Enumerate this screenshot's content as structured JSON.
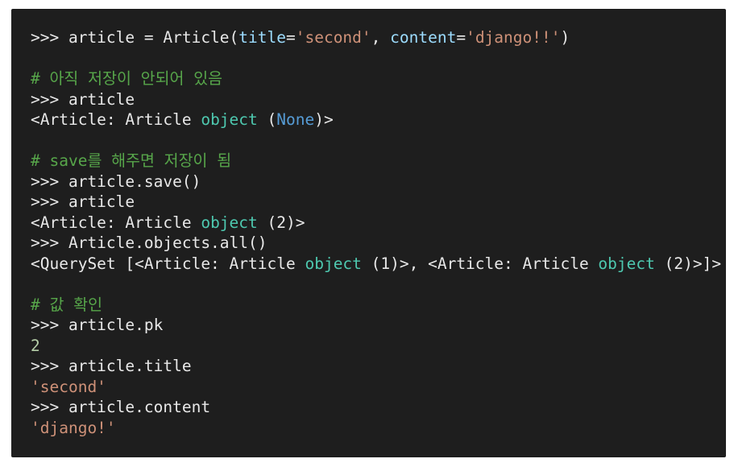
{
  "colors": {
    "background": "#1e1e1e",
    "text": "#e8e8e8",
    "comment": "#57a64a",
    "string": "#ce9178",
    "keyword": "#4ec9b0",
    "parameter": "#9cdcfe",
    "none_literal": "#569cd6",
    "number": "#b5cea8"
  },
  "lines": [
    {
      "tokens": [
        {
          "t": "text",
          "v": ">>> article = Article("
        },
        {
          "t": "param",
          "v": "title"
        },
        {
          "t": "text",
          "v": "="
        },
        {
          "t": "str",
          "v": "'second'"
        },
        {
          "t": "text",
          "v": ", "
        },
        {
          "t": "param",
          "v": "content"
        },
        {
          "t": "text",
          "v": "="
        },
        {
          "t": "str",
          "v": "'django!!'"
        },
        {
          "t": "text",
          "v": ")"
        }
      ]
    },
    {
      "tokens": []
    },
    {
      "tokens": [
        {
          "t": "comment",
          "v": "# 아직 저장이 안되어 있음"
        }
      ]
    },
    {
      "tokens": [
        {
          "t": "text",
          "v": ">>> article"
        }
      ]
    },
    {
      "tokens": [
        {
          "t": "text",
          "v": "<Article: Article "
        },
        {
          "t": "kw",
          "v": "object"
        },
        {
          "t": "text",
          "v": " ("
        },
        {
          "t": "none",
          "v": "None"
        },
        {
          "t": "text",
          "v": ")>"
        }
      ]
    },
    {
      "tokens": []
    },
    {
      "tokens": [
        {
          "t": "comment",
          "v": "# save를 해주면 저장이 됨"
        }
      ]
    },
    {
      "tokens": [
        {
          "t": "text",
          "v": ">>> article.save()"
        }
      ]
    },
    {
      "tokens": [
        {
          "t": "text",
          "v": ">>> article"
        }
      ]
    },
    {
      "tokens": [
        {
          "t": "text",
          "v": "<Article: Article "
        },
        {
          "t": "kw",
          "v": "object"
        },
        {
          "t": "text",
          "v": " (2)>"
        }
      ]
    },
    {
      "tokens": [
        {
          "t": "text",
          "v": ">>> Article.objects.all()"
        }
      ]
    },
    {
      "tokens": [
        {
          "t": "text",
          "v": "<QuerySet [<Article: Article "
        },
        {
          "t": "kw",
          "v": "object"
        },
        {
          "t": "text",
          "v": " (1)>, <Article: Article "
        },
        {
          "t": "kw",
          "v": "object"
        },
        {
          "t": "text",
          "v": " (2)>]>"
        }
      ]
    },
    {
      "tokens": []
    },
    {
      "tokens": [
        {
          "t": "comment",
          "v": "# 값 확인"
        }
      ]
    },
    {
      "tokens": [
        {
          "t": "text",
          "v": ">>> article.pk"
        }
      ]
    },
    {
      "tokens": [
        {
          "t": "num",
          "v": "2"
        }
      ]
    },
    {
      "tokens": [
        {
          "t": "text",
          "v": ">>> article.title"
        }
      ]
    },
    {
      "tokens": [
        {
          "t": "str",
          "v": "'second'"
        }
      ]
    },
    {
      "tokens": [
        {
          "t": "text",
          "v": ">>> article.content"
        }
      ]
    },
    {
      "tokens": [
        {
          "t": "str",
          "v": "'django!'"
        }
      ]
    }
  ]
}
